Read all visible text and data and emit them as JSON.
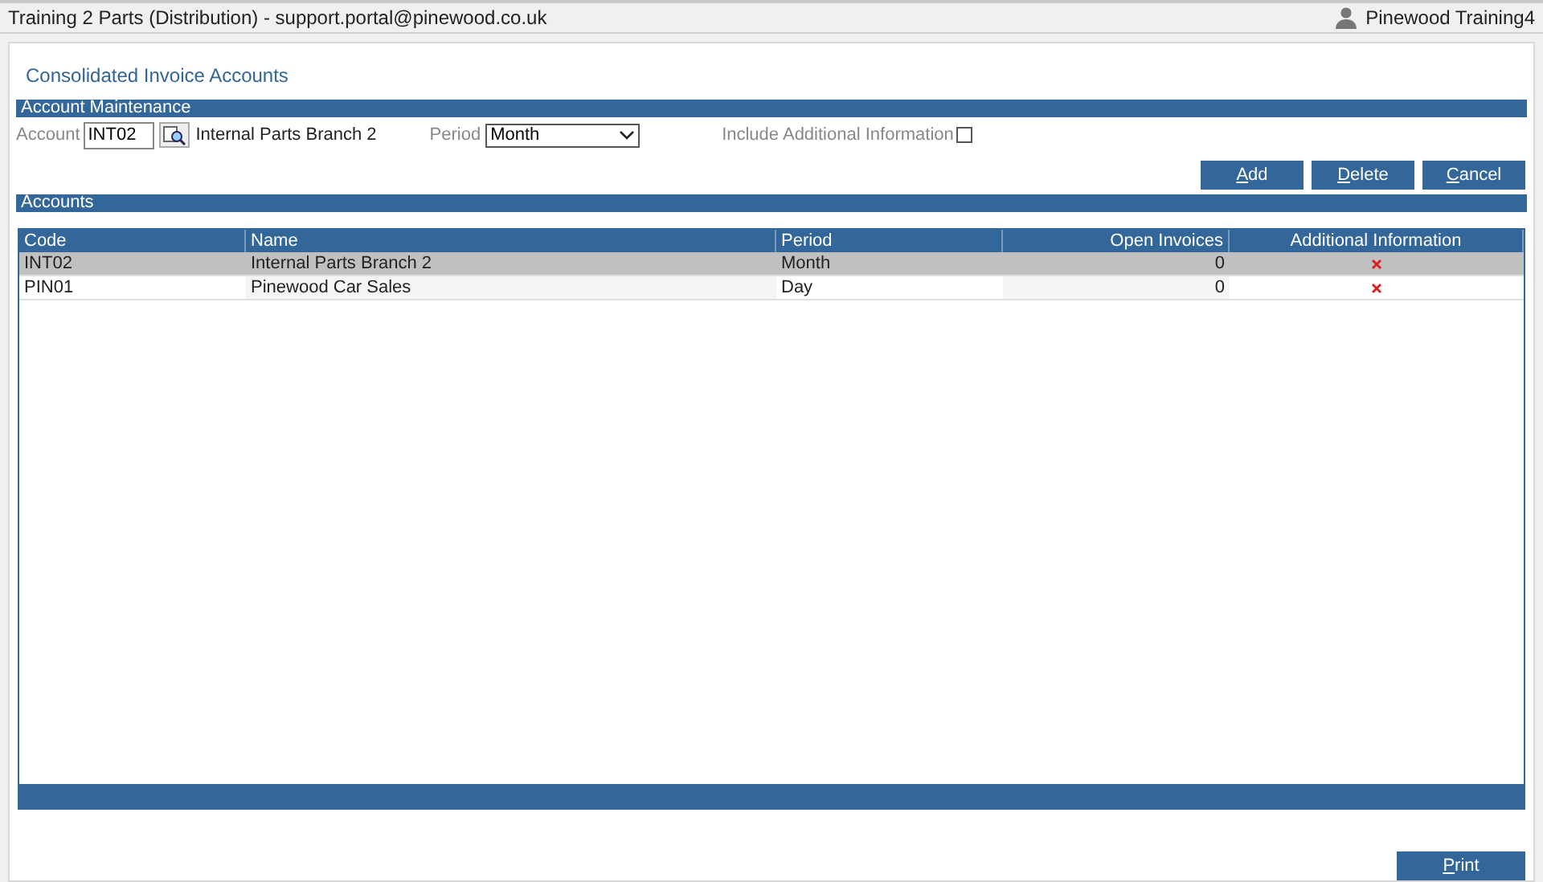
{
  "window": {
    "title": "Training 2 Parts (Distribution) - support.portal@pinewood.co.uk",
    "user": "Pinewood Training4"
  },
  "page_title": "Consolidated Invoice Accounts",
  "account_maintenance": {
    "header": "Account Maintenance",
    "account_label": "Account",
    "account_value": "INT02",
    "account_name": "Internal Parts Branch 2",
    "period_label": "Period",
    "period_value": "Month",
    "include_label": "Include Additional Information",
    "include_checked": false,
    "buttons": [
      "Add",
      "Delete",
      "Cancel"
    ]
  },
  "accounts": {
    "header": "Accounts",
    "columns": [
      "Code",
      "Name",
      "Period",
      "Open Invoices",
      "Additional Information"
    ],
    "rows": [
      {
        "code": "INT02",
        "name": "Internal Parts Branch 2",
        "period": "Month",
        "open_invoices": "0",
        "additional_info": false,
        "selected": true
      },
      {
        "code": "PIN01",
        "name": "Pinewood Car Sales",
        "period": "Day",
        "open_invoices": "0",
        "additional_info": false,
        "selected": false
      }
    ]
  },
  "footer_buttons": [
    "Print"
  ]
}
